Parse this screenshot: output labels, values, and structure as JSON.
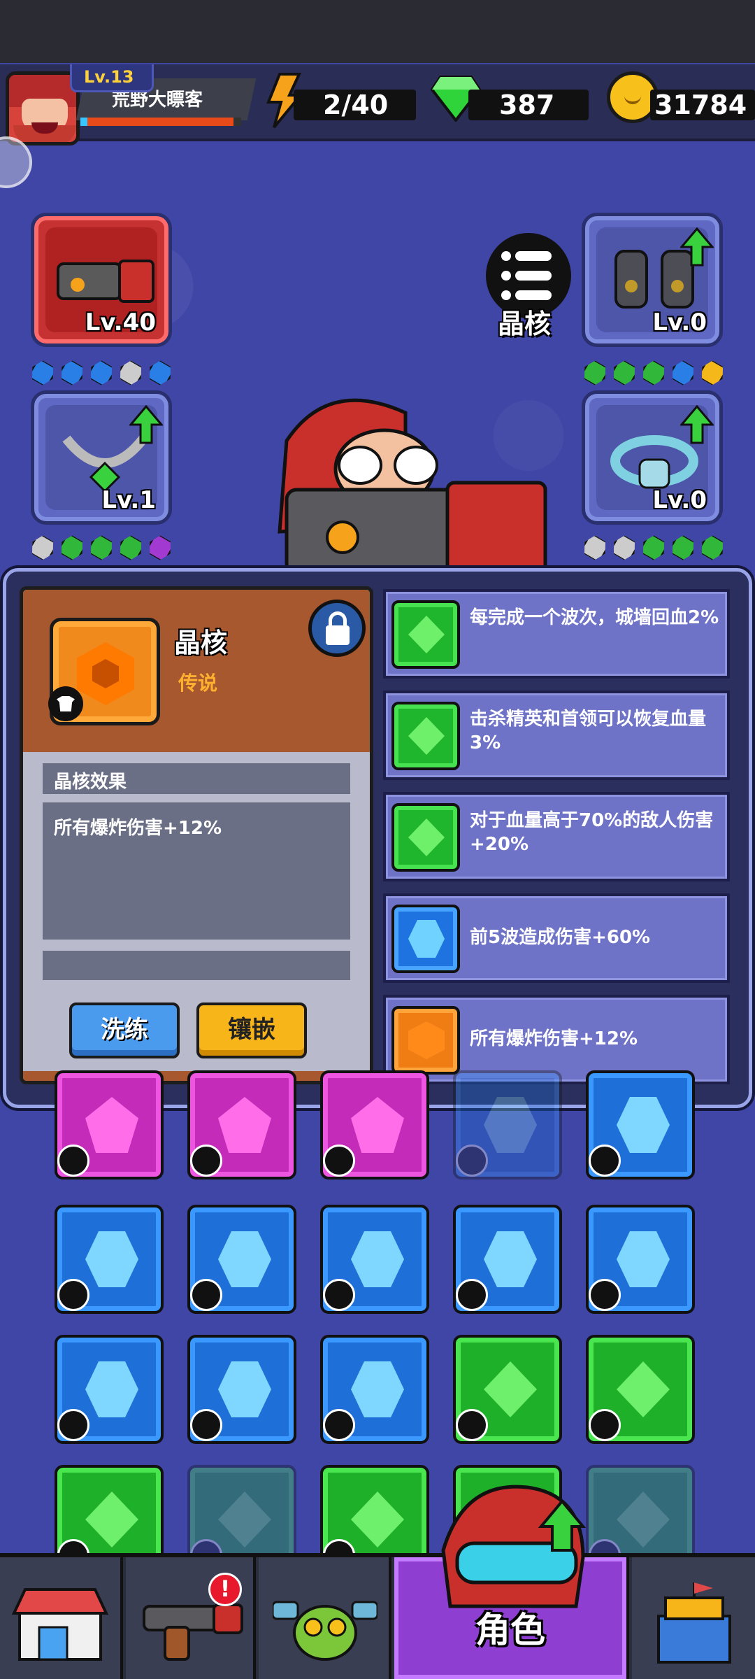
{
  "player": {
    "name": "荒野大瞟客",
    "level": "Lv.13",
    "hp_fraction": 0.95
  },
  "resources": {
    "energy": "2/40",
    "gems": "387",
    "coins": "31784"
  },
  "equipment": {
    "weapon": {
      "level": "Lv.40"
    },
    "armor_top_right": {
      "level": "Lv.0"
    },
    "necklace": {
      "level": "Lv.1"
    },
    "ring": {
      "level": "Lv.0"
    },
    "crystal_button_label": "晶核"
  },
  "detail": {
    "title": "晶核",
    "rarity": "传说",
    "effect_header": "晶核效果",
    "effect_text": "所有爆炸伤害+12%",
    "wash_button": "洗练",
    "inlay_button": "镶嵌"
  },
  "options": [
    {
      "color": "green",
      "text": "每完成一个波次，城墙回血2%"
    },
    {
      "color": "green",
      "text": "击杀精英和首领可以恢复血量3%"
    },
    {
      "color": "green",
      "text": "对于血量高于70%的敌人伤害+20%"
    },
    {
      "color": "blue",
      "text": "前5波造成伤害+60%"
    },
    {
      "color": "orange",
      "text": "所有爆炸伤害+12%"
    }
  ],
  "nav": {
    "active_label": "角色",
    "alert_badge": "!"
  }
}
